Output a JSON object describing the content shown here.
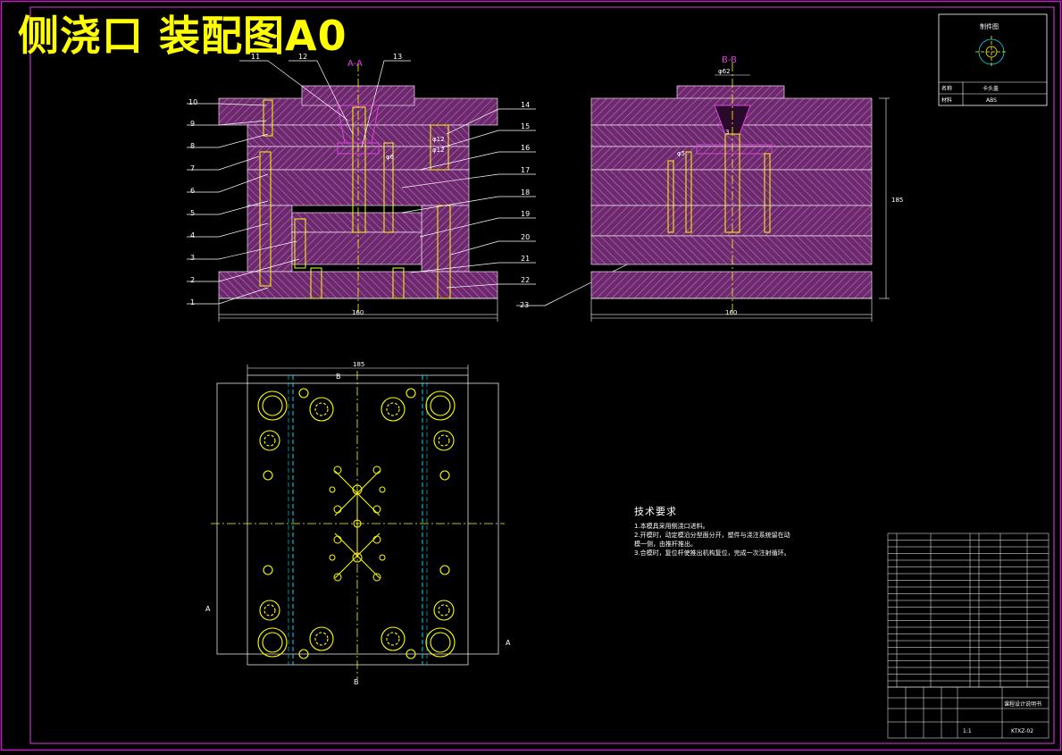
{
  "drawing_title": "侧浇口 装配图A0",
  "views": {
    "section_aa": {
      "label": "A-A",
      "width_dim": "160",
      "callouts": [
        "1",
        "2",
        "3",
        "4",
        "5",
        "6",
        "7",
        "8",
        "9",
        "10",
        "11",
        "12",
        "13",
        "14",
        "15",
        "16",
        "17",
        "18",
        "19",
        "20",
        "21",
        "22",
        "23"
      ],
      "dim_d12": "φ12",
      "dim_d6": "φ6",
      "dim_d12b": "φ12"
    },
    "section_bb": {
      "label": "B-B",
      "top_dim": "φ62",
      "width_dim": "160",
      "height_dim": "185",
      "dim_d3": "3",
      "dim_d5": "φ5"
    },
    "plan": {
      "top_dim": "185",
      "section_marks": [
        "A",
        "A",
        "B",
        "B"
      ]
    }
  },
  "part_drawing": {
    "heading": "制件图",
    "row1_label": "名称",
    "row1_value": "卡头盖",
    "row2_label": "材料",
    "row2_value": "ABS"
  },
  "tech_requirements": {
    "heading": "技术要求",
    "items": [
      "1.本模具采用侧浇口进料。",
      "2.开模时，动定模沿分型面分开，塑件与浇注系统留在动模一侧，由推杆推出。",
      "3.合模时，复位杆使推出机构复位，完成一次注射循环。"
    ]
  },
  "title_block": {
    "school": "课程设计说明书",
    "drawing_no": "KTXZ-02",
    "scale": "1:1"
  }
}
